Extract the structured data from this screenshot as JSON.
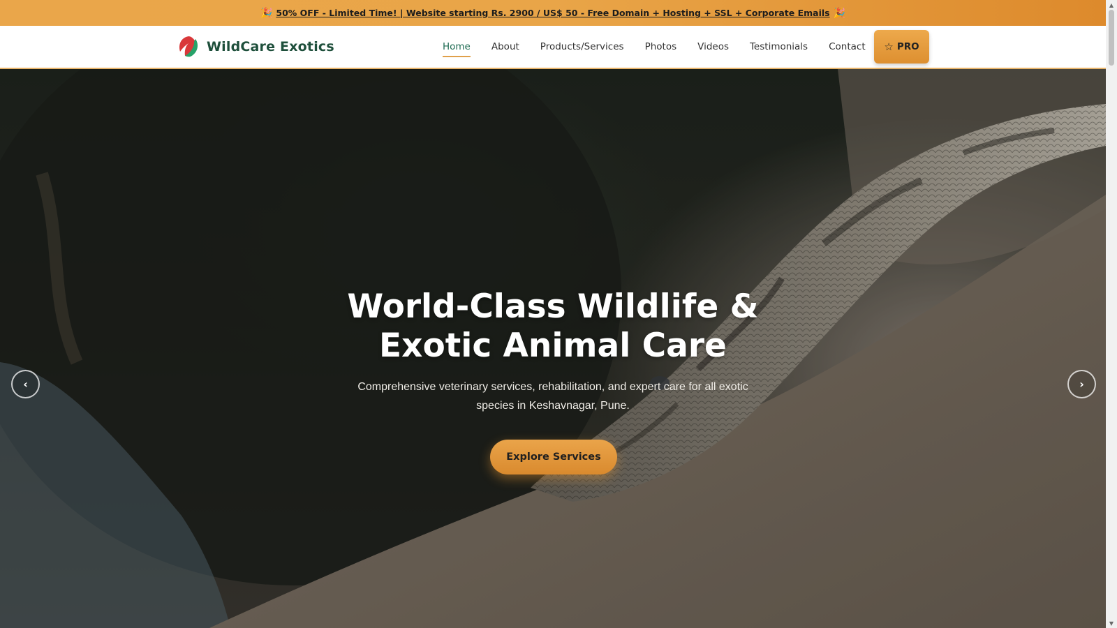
{
  "promo": {
    "emoji": "🎉",
    "text": "50% OFF - Limited Time! | Website starting Rs. 2900 / US$ 50 - Free Domain + Hosting + SSL + Corporate Emails"
  },
  "header": {
    "brand": "WildCare Exotics",
    "nav": [
      "Home",
      "About",
      "Products/Services",
      "Photos",
      "Videos",
      "Testimonials",
      "Contact"
    ],
    "active_nav": "Home",
    "pro_label": "PRO",
    "accent_color": "#e0a04a",
    "brand_color": "#1e4f3b"
  },
  "hero": {
    "title_line1": "World-Class Wildlife &",
    "title_line2": "Exotic Animal Care",
    "subtitle_line1": "Comprehensive veterinary services, rehabilitation, and expert care for all exotic",
    "subtitle_line2": "species in Keshavnagar, Pune.",
    "cta_label": "Explore Services",
    "prev_icon": "chevron-left-icon",
    "next_icon": "chevron-right-icon"
  }
}
